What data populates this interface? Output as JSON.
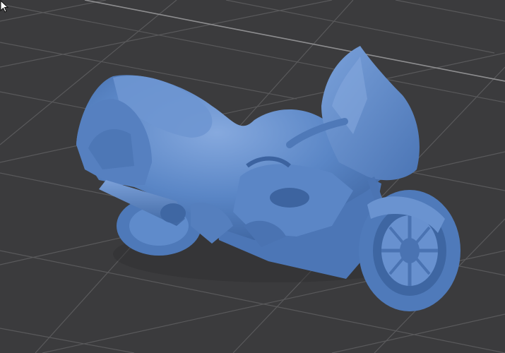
{
  "viewport": {
    "background_color": "#3b3b3d",
    "grid_color": "#5c5c5e",
    "grid_highlight_color": "#8a8a8c",
    "model_color": "#5b87c8",
    "model_shade_color": "#3f67a3",
    "model_highlight_color": "#7ea4dc"
  },
  "scene": {
    "model": "motorcycle",
    "grid": true,
    "cursor": "arrow-cursor-icon"
  }
}
